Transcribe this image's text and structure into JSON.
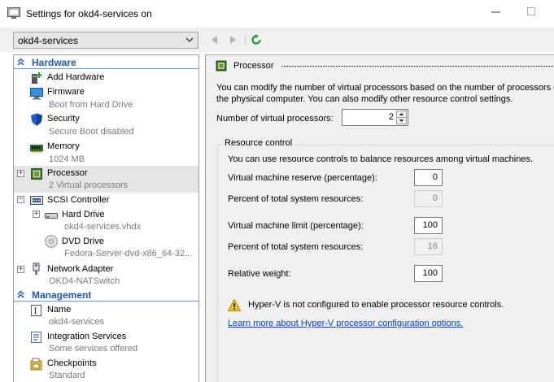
{
  "window": {
    "title": "Settings for okd4-services on"
  },
  "toolbar": {
    "vm_selector": "okd4-services",
    "icons": {
      "back": "back-arrow-icon",
      "forward": "forward-arrow-icon",
      "refresh": "refresh-icon"
    }
  },
  "sidebar": {
    "hardware_header": "Hardware",
    "management_header": "Management",
    "items": [
      {
        "name": "Add Hardware",
        "sub": "",
        "icon": "add-hardware-icon"
      },
      {
        "name": "Firmware",
        "sub": "Boot from Hard Drive",
        "icon": "firmware-icon"
      },
      {
        "name": "Security",
        "sub": "Secure Boot disabled",
        "icon": "shield-icon"
      },
      {
        "name": "Memory",
        "sub": "1024 MB",
        "icon": "memory-icon"
      },
      {
        "name": "Processor",
        "sub": "2 Virtual processors",
        "icon": "processor-icon",
        "selected": true
      },
      {
        "name": "SCSI Controller",
        "sub": "",
        "icon": "scsi-controller-icon"
      },
      {
        "name": "Hard Drive",
        "sub": "okd4-services.vhdx",
        "icon": "hard-drive-icon"
      },
      {
        "name": "DVD Drive",
        "sub": "Fedora-Server-dvd-x86_64-32...",
        "icon": "dvd-drive-icon"
      },
      {
        "name": "Network Adapter",
        "sub": "OKD4-NATSwitch",
        "icon": "network-adapter-icon"
      },
      {
        "name": "Name",
        "sub": "okd4-services",
        "icon": "name-icon"
      },
      {
        "name": "Integration Services",
        "sub": "Some services offered",
        "icon": "integration-services-icon"
      },
      {
        "name": "Checkpoints",
        "sub": "Standard",
        "icon": "checkpoints-icon"
      }
    ]
  },
  "processor": {
    "title": "Processor",
    "description_line1": "You can modify the number of virtual processors based on the number of processors on",
    "description_line2": "the physical computer. You can also modify other resource control settings.",
    "num_label": "Number of virtual processors:",
    "num_value": "2",
    "resource_control": {
      "title": "Resource control",
      "description": "You can use resource controls to balance resources among virtual machines.",
      "reserve_label": "Virtual machine reserve (percentage):",
      "reserve_value": "0",
      "reserve_pct_label": "Percent of total system resources:",
      "reserve_pct_value": "0",
      "limit_label": "Virtual machine limit (percentage):",
      "limit_value": "100",
      "limit_pct_label": "Percent of total system resources:",
      "limit_pct_value": "16",
      "weight_label": "Relative weight:",
      "weight_value": "100"
    },
    "warning": "Hyper-V is not configured to enable processor resource controls.",
    "learn_more": "Learn more about Hyper-V processor configuration options."
  },
  "colors": {
    "accent": "#1d58b8",
    "link": "#0645ad",
    "selected_bg": "#e5e5e5",
    "panel_bg": "#f0f0f0"
  }
}
